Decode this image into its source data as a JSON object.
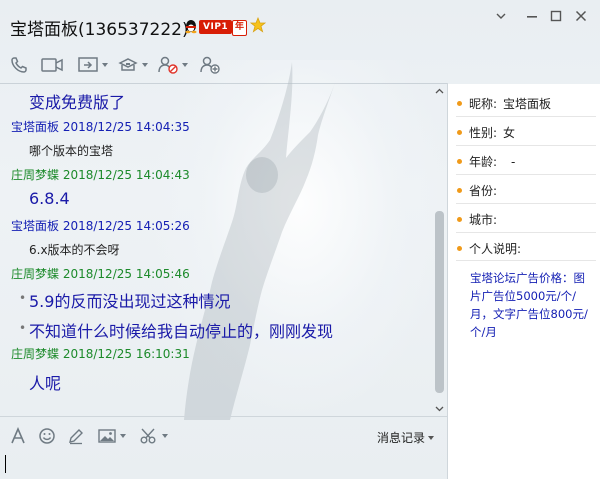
{
  "window": {
    "title": "宝塔面板(136537222)",
    "vip_label": "VIP1",
    "year_label": "年"
  },
  "toolbar": {
    "icons": [
      "phone-icon",
      "video-icon",
      "share-screen-icon",
      "apps-icon",
      "block-user-icon",
      "add-friend-icon"
    ]
  },
  "chat": {
    "messages": [
      {
        "type": "text",
        "text": "变成免费版了"
      },
      {
        "type": "header",
        "sender": "宝塔面板",
        "time": "2018/12/25 14:04:35"
      },
      {
        "type": "text",
        "text": "哪个版本的宝塔"
      },
      {
        "type": "header",
        "sender": "庄周梦蝶",
        "time": "2018/12/25 14:04:43"
      },
      {
        "type": "text",
        "text": "6.8.4"
      },
      {
        "type": "header",
        "sender": "宝塔面板",
        "time": "2018/12/25 14:05:26"
      },
      {
        "type": "text",
        "text": "6.x版本的不会呀"
      },
      {
        "type": "header",
        "sender": "庄周梦蝶",
        "time": "2018/12/25 14:05:46"
      },
      {
        "type": "text",
        "text": "5.9的反而没出现过这种情况"
      },
      {
        "type": "text",
        "text": "不知道什么时候给我自动停止的，刚刚发现"
      },
      {
        "type": "header",
        "sender": "庄周梦蝶",
        "time": "2018/12/25 16:10:31"
      },
      {
        "type": "text",
        "text": "人呢"
      }
    ]
  },
  "input_toolbar": {
    "history_label": "消息记录"
  },
  "profile": {
    "nickname_label": "昵称:",
    "nickname": "宝塔面板",
    "gender_label": "性别:",
    "gender": "女",
    "age_label": "年龄:",
    "age": "-",
    "province_label": "省份:",
    "city_label": "城市:",
    "bio_label": "个人说明:",
    "bio": "宝塔论坛广告价格：图片广告位5000元/个/月，文字广告位800元/个/月"
  },
  "colors": {
    "link_blue": "#1520b4",
    "sender_green": "#1c8a2a",
    "vip_red": "#d81e06",
    "dot_orange": "#f09a1a"
  }
}
